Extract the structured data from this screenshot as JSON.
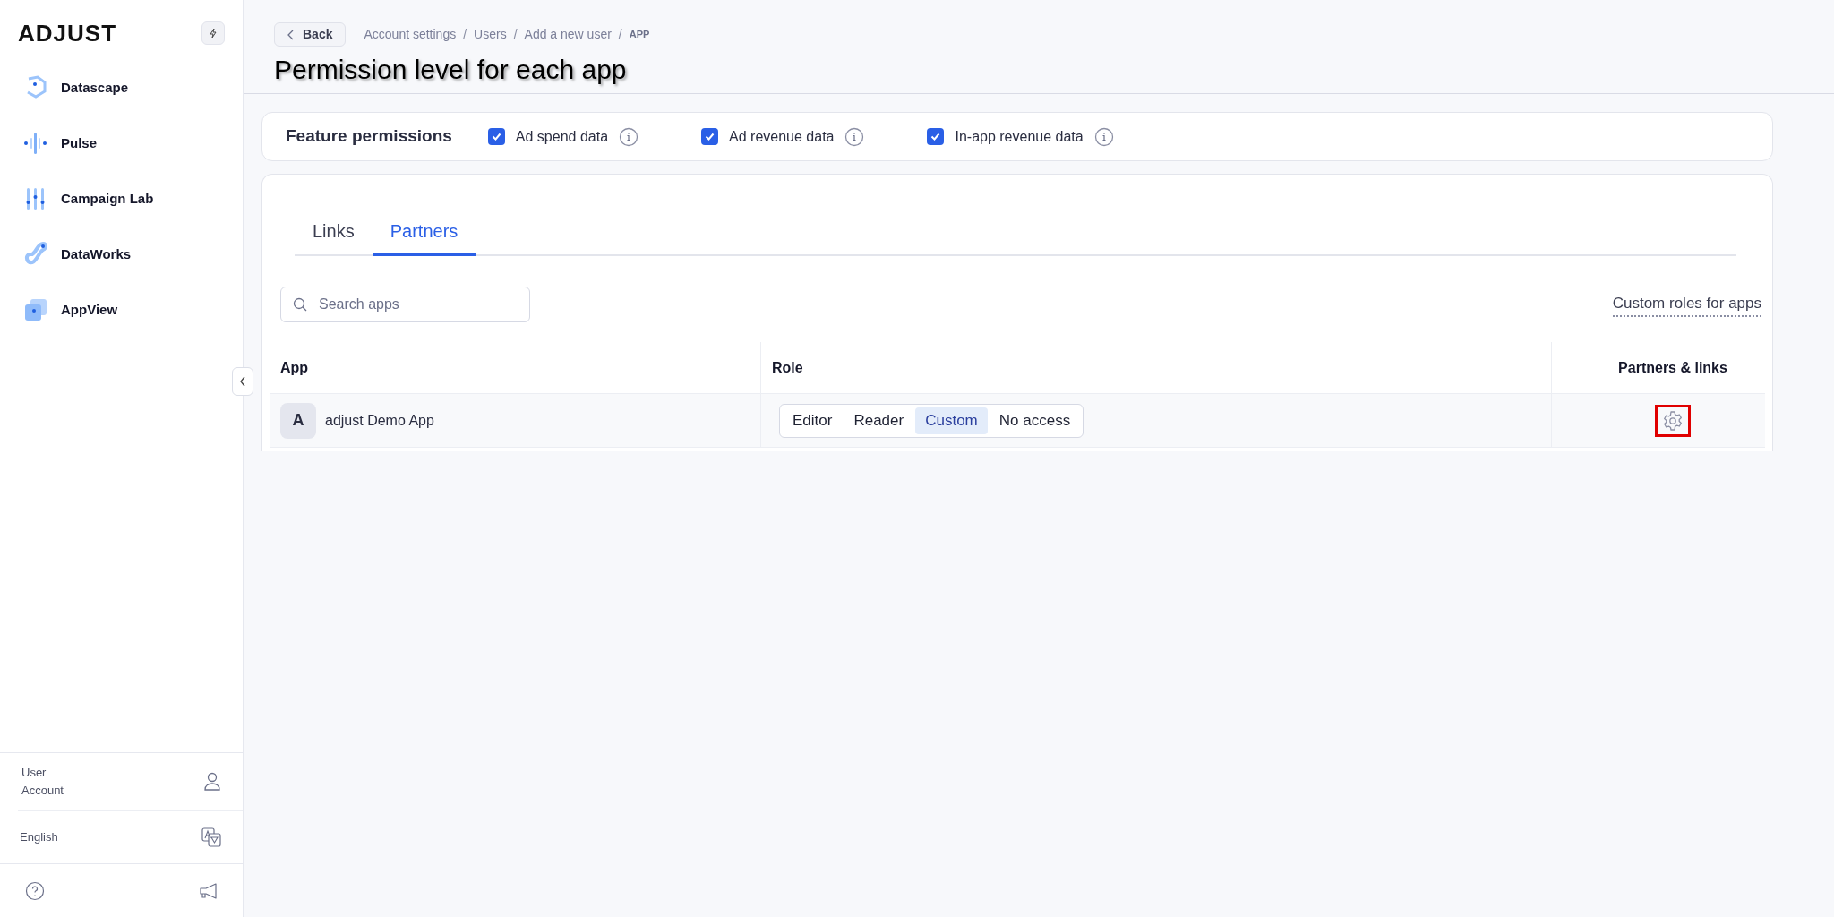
{
  "sidebar": {
    "logo": "ADJUST",
    "nav": [
      {
        "label": "Datascape",
        "kind": "datascape"
      },
      {
        "label": "Pulse",
        "kind": "pulse"
      },
      {
        "label": "Campaign Lab",
        "kind": "campaign"
      },
      {
        "label": "DataWorks",
        "kind": "dataworks"
      },
      {
        "label": "AppView",
        "kind": "appview"
      }
    ],
    "account": [
      "User",
      "Account"
    ],
    "language": "English"
  },
  "header": {
    "back": "Back",
    "separator": "/",
    "breadcrumbs": [
      {
        "label": "Account settings",
        "kind": "link"
      },
      {
        "label": "Users",
        "kind": "link"
      },
      {
        "label": "Add a new user",
        "kind": "link"
      },
      {
        "label": "APP",
        "kind": "current"
      }
    ],
    "title": "Permission level for each app"
  },
  "feature_permissions": {
    "label": "Feature permissions",
    "items": [
      {
        "label": "Ad spend data",
        "checked": true
      },
      {
        "label": "Ad revenue data",
        "checked": true
      },
      {
        "label": "In-app revenue data",
        "checked": true
      }
    ]
  },
  "tabs": [
    {
      "label": "Links",
      "selected": false
    },
    {
      "label": "Partners",
      "selected": true
    }
  ],
  "search": {
    "placeholder": "Search apps"
  },
  "custom_roles_link": "Custom roles for apps",
  "table": {
    "columns": [
      "App",
      "Role",
      "Partners & links"
    ],
    "rows": [
      {
        "initial": "A",
        "app": "adjust Demo App",
        "roles": [
          {
            "label": "Editor",
            "selected": false
          },
          {
            "label": "Reader",
            "selected": false
          },
          {
            "label": "Custom",
            "selected": true
          },
          {
            "label": "No access",
            "selected": false
          }
        ],
        "settings_highlighted": true
      }
    ]
  }
}
